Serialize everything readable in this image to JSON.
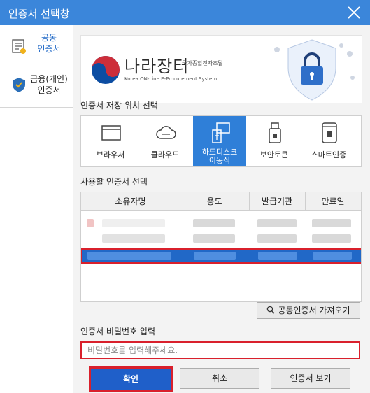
{
  "window": {
    "title": "인증서 선택창"
  },
  "sidebar": {
    "items": [
      {
        "label": "공동\n인증서",
        "icon": "certificate-doc-icon",
        "active": true
      },
      {
        "label": "금융(개인)\n인증서",
        "icon": "shield-cert-icon",
        "active": false
      }
    ]
  },
  "banner": {
    "brand": "나라장터",
    "brand_sub": "국가종합전자조달",
    "brand_en": "Korea ON-Line E-Procurement System"
  },
  "storage": {
    "heading": "인증서 저장 위치 선택",
    "items": [
      {
        "label": "브라우저",
        "icon": "browser-icon"
      },
      {
        "label": "클라우드",
        "icon": "cloud-icon"
      },
      {
        "label": "하드디스크\n이동식",
        "icon": "usb-disk-icon",
        "selected": true
      },
      {
        "label": "보안토큰",
        "icon": "security-token-icon"
      },
      {
        "label": "스마트인증",
        "icon": "smartphone-icon"
      }
    ]
  },
  "cert_table": {
    "heading": "사용할 인증서 선택",
    "columns": [
      "소유자명",
      "용도",
      "발급기관",
      "만료일"
    ]
  },
  "buttons": {
    "import": "공동인증서 가져오기",
    "ok": "확인",
    "cancel": "취소",
    "view": "인증서 보기"
  },
  "password": {
    "heading": "인증서 비밀번호 입력",
    "placeholder": "비밀번호를 입력해주세요."
  },
  "colors": {
    "accent": "#3b86da",
    "highlight": "#d9202c"
  }
}
